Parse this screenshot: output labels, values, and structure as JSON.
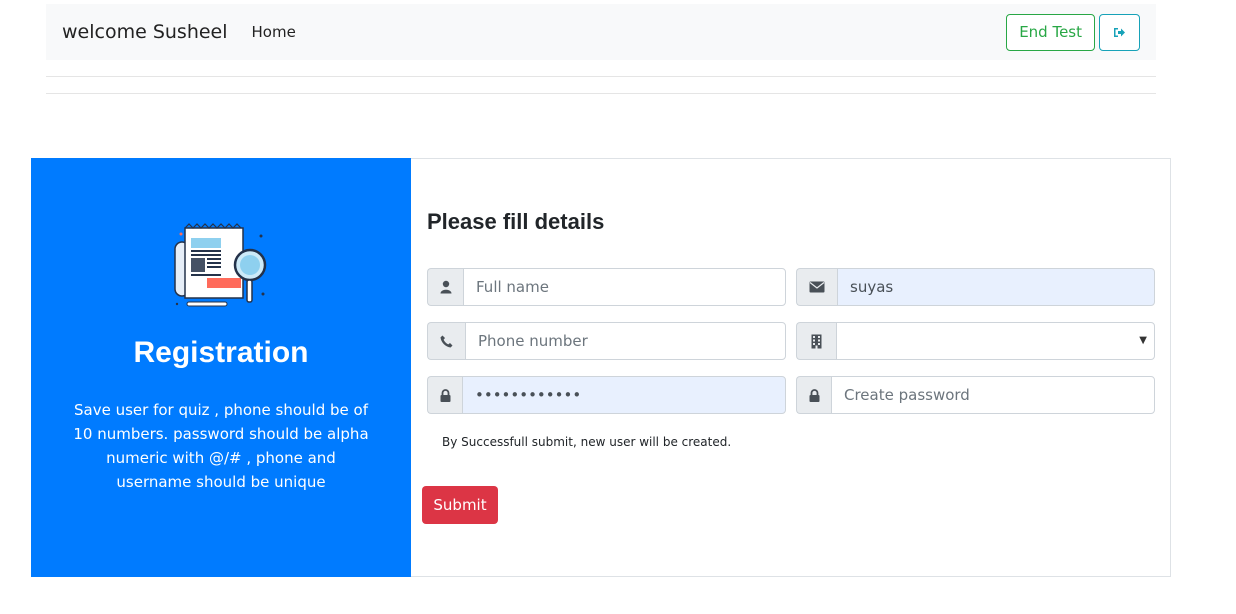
{
  "navbar": {
    "brand": "welcome Susheel",
    "home_link": "Home",
    "end_test_label": "End Test",
    "logout_icon": "sign-out-icon"
  },
  "sidebar": {
    "illustration_icon": "document-magnifier-icon",
    "title": "Registration",
    "description": "Save user for quiz , phone should be of 10 numbers. password should be alpha numeric with @/# , phone and username should be unique"
  },
  "form": {
    "title": "Please fill details",
    "full_name": {
      "icon": "user-icon",
      "placeholder": "Full name",
      "value": ""
    },
    "email": {
      "icon": "envelope-icon",
      "placeholder": "",
      "value": "suyas"
    },
    "phone": {
      "icon": "phone-icon",
      "placeholder": "Phone number",
      "value": ""
    },
    "building": {
      "icon": "building-icon",
      "selected": ""
    },
    "password": {
      "icon": "lock-icon",
      "placeholder": "",
      "value": "passwordvalu"
    },
    "create_password": {
      "icon": "lock-icon",
      "placeholder": "Create password",
      "value": ""
    },
    "note": "By Successfull submit, new user will be created.",
    "submit_label": "Submit"
  },
  "colors": {
    "primary": "#007bff",
    "danger": "#dc3545",
    "success": "#28a745",
    "info": "#17a2b8",
    "autofill": "#e8f0fe"
  }
}
